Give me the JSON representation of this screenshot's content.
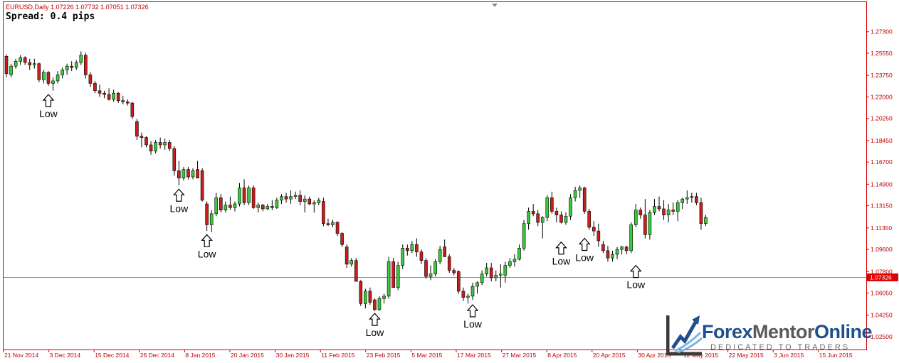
{
  "header": {
    "symbol_line": "EURUSD,Daily  1.07226 1.07732 1.07051 1.07326",
    "spread": "Spread: 0.4 pips"
  },
  "colors": {
    "bull": "#3cc83c",
    "bear": "#c81e1e",
    "frame": "#d00000",
    "price_line": "#8c8c8c",
    "price_tag_bg": "#e00000"
  },
  "logo": {
    "part1": "Forex",
    "part2": "Mentor",
    "part3": "Online",
    "tagline": "DEDICATED TO TRADERS"
  },
  "chart_data": {
    "type": "candlestick",
    "instrument": "EURUSD",
    "timeframe": "Daily",
    "ylim": [
      1.0175,
      1.2838
    ],
    "yticks": [
      "1.27300",
      "1.25550",
      "1.23750",
      "1.22000",
      "1.20250",
      "1.18450",
      "1.16700",
      "1.14900",
      "1.13150",
      "1.11350",
      "1.09600",
      "1.07800",
      "1.06050",
      "1.04250",
      "1.02500"
    ],
    "xticks": [
      "21 Nov 2014",
      "3 Dec 2014",
      "15 Dec 2014",
      "26 Dec 2014",
      "8 Jan 2015",
      "20 Jan 2015",
      "30 Jan 2015",
      "11 Feb 2015",
      "23 Feb 2015",
      "5 Mar 2015",
      "17 Mar 2015",
      "27 Mar 2015",
      "8 Apr 2015",
      "20 Apr 2015",
      "30 Apr 2015",
      "12 May 2015",
      "22 May 2015",
      "3 Jun 2015",
      "15 Jun 2015"
    ],
    "current_price": "1.07326",
    "candles": [
      [
        1.253,
        1.2545,
        1.236,
        1.239
      ],
      [
        1.238,
        1.247,
        1.236,
        1.245
      ],
      [
        1.245,
        1.251,
        1.243,
        1.249
      ],
      [
        1.249,
        1.254,
        1.246,
        1.252
      ],
      [
        1.252,
        1.253,
        1.246,
        1.248
      ],
      [
        1.248,
        1.251,
        1.242,
        1.246
      ],
      [
        1.246,
        1.251,
        1.243,
        1.247
      ],
      [
        1.247,
        1.248,
        1.232,
        1.234
      ],
      [
        1.234,
        1.242,
        1.231,
        1.24
      ],
      [
        1.24,
        1.241,
        1.229,
        1.231
      ],
      [
        1.231,
        1.236,
        1.225,
        1.233
      ],
      [
        1.233,
        1.241,
        1.231,
        1.238
      ],
      [
        1.238,
        1.244,
        1.235,
        1.242
      ],
      [
        1.242,
        1.247,
        1.238,
        1.245
      ],
      [
        1.245,
        1.249,
        1.241,
        1.244
      ],
      [
        1.244,
        1.25,
        1.242,
        1.248
      ],
      [
        1.248,
        1.257,
        1.246,
        1.254
      ],
      [
        1.254,
        1.256,
        1.235,
        1.238
      ],
      [
        1.238,
        1.24,
        1.228,
        1.231
      ],
      [
        1.231,
        1.233,
        1.223,
        1.225
      ],
      [
        1.225,
        1.23,
        1.22,
        1.223
      ],
      [
        1.223,
        1.225,
        1.219,
        1.222
      ],
      [
        1.222,
        1.227,
        1.217,
        1.218
      ],
      [
        1.218,
        1.226,
        1.216,
        1.223
      ],
      [
        1.223,
        1.224,
        1.215,
        1.217
      ],
      [
        1.217,
        1.221,
        1.214,
        1.216
      ],
      [
        1.216,
        1.218,
        1.213,
        1.215
      ],
      [
        1.215,
        1.216,
        1.202,
        1.204
      ],
      [
        1.2,
        1.202,
        1.185,
        1.188
      ],
      [
        1.188,
        1.191,
        1.179,
        1.187
      ],
      [
        1.187,
        1.188,
        1.179,
        1.181
      ],
      [
        1.181,
        1.184,
        1.173,
        1.176
      ],
      [
        1.176,
        1.185,
        1.174,
        1.183
      ],
      [
        1.183,
        1.187,
        1.178,
        1.181
      ],
      [
        1.181,
        1.186,
        1.177,
        1.183
      ],
      [
        1.183,
        1.185,
        1.176,
        1.178
      ],
      [
        1.178,
        1.18,
        1.156,
        1.16
      ],
      [
        1.16,
        1.168,
        1.148,
        1.154
      ],
      [
        1.154,
        1.163,
        1.152,
        1.161
      ],
      [
        1.161,
        1.163,
        1.153,
        1.155
      ],
      [
        1.155,
        1.162,
        1.153,
        1.16
      ],
      [
        1.161,
        1.168,
        1.155,
        1.154
      ],
      [
        1.16,
        1.162,
        1.135,
        1.136
      ],
      [
        1.133,
        1.135,
        1.111,
        1.116
      ],
      [
        1.116,
        1.128,
        1.11,
        1.125
      ],
      [
        1.125,
        1.142,
        1.123,
        1.138
      ],
      [
        1.138,
        1.141,
        1.126,
        1.128
      ],
      [
        1.128,
        1.135,
        1.126,
        1.132
      ],
      [
        1.132,
        1.139,
        1.128,
        1.13
      ],
      [
        1.13,
        1.135,
        1.127,
        1.133
      ],
      [
        1.133,
        1.15,
        1.131,
        1.146
      ],
      [
        1.146,
        1.153,
        1.132,
        1.134
      ],
      [
        1.134,
        1.148,
        1.132,
        1.146
      ],
      [
        1.146,
        1.148,
        1.129,
        1.13
      ],
      [
        1.13,
        1.134,
        1.126,
        1.132
      ],
      [
        1.132,
        1.133,
        1.127,
        1.129
      ],
      [
        1.129,
        1.133,
        1.128,
        1.131
      ],
      [
        1.131,
        1.136,
        1.128,
        1.13
      ],
      [
        1.13,
        1.138,
        1.129,
        1.136
      ],
      [
        1.136,
        1.141,
        1.133,
        1.139
      ],
      [
        1.139,
        1.142,
        1.134,
        1.137
      ],
      [
        1.137,
        1.144,
        1.133,
        1.139
      ],
      [
        1.139,
        1.143,
        1.137,
        1.14
      ],
      [
        1.14,
        1.144,
        1.132,
        1.135
      ],
      [
        1.135,
        1.14,
        1.126,
        1.137
      ],
      [
        1.137,
        1.139,
        1.132,
        1.133
      ],
      [
        1.133,
        1.136,
        1.126,
        1.134
      ],
      [
        1.134,
        1.138,
        1.132,
        1.136
      ],
      [
        1.135,
        1.138,
        1.115,
        1.117
      ],
      [
        1.117,
        1.121,
        1.115,
        1.116
      ],
      [
        1.116,
        1.12,
        1.114,
        1.118
      ],
      [
        1.118,
        1.119,
        1.107,
        1.109
      ],
      [
        1.109,
        1.11,
        1.098,
        1.1
      ],
      [
        1.098,
        1.1,
        1.081,
        1.084
      ],
      [
        1.084,
        1.089,
        1.082,
        1.087
      ],
      [
        1.087,
        1.089,
        1.07,
        1.07
      ],
      [
        1.07,
        1.071,
        1.05,
        1.052
      ],
      [
        1.052,
        1.064,
        1.048,
        1.062
      ],
      [
        1.062,
        1.065,
        1.051,
        1.053
      ],
      [
        1.055,
        1.056,
        1.046,
        1.047
      ],
      [
        1.047,
        1.058,
        1.046,
        1.056
      ],
      [
        1.056,
        1.06,
        1.052,
        1.058
      ],
      [
        1.058,
        1.09,
        1.056,
        1.086
      ],
      [
        1.086,
        1.089,
        1.065,
        1.065
      ],
      [
        1.065,
        1.086,
        1.063,
        1.083
      ],
      [
        1.083,
        1.1,
        1.08,
        1.097
      ],
      [
        1.097,
        1.1,
        1.091,
        1.095
      ],
      [
        1.095,
        1.103,
        1.093,
        1.1
      ],
      [
        1.1,
        1.105,
        1.09,
        1.094
      ],
      [
        1.094,
        1.096,
        1.084,
        1.087
      ],
      [
        1.087,
        1.089,
        1.072,
        1.074
      ],
      [
        1.074,
        1.083,
        1.071,
        1.076
      ],
      [
        1.076,
        1.088,
        1.074,
        1.086
      ],
      [
        1.086,
        1.099,
        1.084,
        1.096
      ],
      [
        1.098,
        1.104,
        1.09,
        1.09
      ],
      [
        1.09,
        1.092,
        1.077,
        1.079
      ],
      [
        1.079,
        1.081,
        1.075,
        1.077
      ],
      [
        1.078,
        1.079,
        1.06,
        1.062
      ],
      [
        1.062,
        1.065,
        1.054,
        1.057
      ],
      [
        1.057,
        1.06,
        1.052,
        1.058
      ],
      [
        1.058,
        1.069,
        1.055,
        1.066
      ],
      [
        1.066,
        1.07,
        1.06,
        1.069
      ],
      [
        1.069,
        1.079,
        1.067,
        1.076
      ],
      [
        1.076,
        1.085,
        1.074,
        1.081
      ],
      [
        1.081,
        1.085,
        1.07,
        1.073
      ],
      [
        1.073,
        1.079,
        1.07,
        1.075
      ],
      [
        1.075,
        1.084,
        1.065,
        1.076
      ],
      [
        1.075,
        1.086,
        1.069,
        1.083
      ],
      [
        1.083,
        1.089,
        1.081,
        1.086
      ],
      [
        1.086,
        1.092,
        1.082,
        1.088
      ],
      [
        1.088,
        1.1,
        1.087,
        1.097
      ],
      [
        1.097,
        1.12,
        1.095,
        1.117
      ],
      [
        1.117,
        1.13,
        1.112,
        1.127
      ],
      [
        1.127,
        1.133,
        1.123,
        1.125
      ],
      [
        1.125,
        1.128,
        1.115,
        1.118
      ],
      [
        1.118,
        1.123,
        1.105,
        1.122
      ],
      [
        1.122,
        1.14,
        1.119,
        1.138
      ],
      [
        1.138,
        1.143,
        1.125,
        1.127
      ],
      [
        1.127,
        1.13,
        1.118,
        1.124
      ],
      [
        1.124,
        1.127,
        1.117,
        1.118
      ],
      [
        1.118,
        1.126,
        1.116,
        1.123
      ],
      [
        1.123,
        1.141,
        1.12,
        1.138
      ],
      [
        1.138,
        1.147,
        1.135,
        1.144
      ],
      [
        1.144,
        1.148,
        1.138,
        1.146
      ],
      [
        1.146,
        1.147,
        1.125,
        1.127
      ],
      [
        1.127,
        1.129,
        1.112,
        1.114
      ],
      [
        1.114,
        1.119,
        1.107,
        1.111
      ],
      [
        1.111,
        1.117,
        1.098,
        1.103
      ],
      [
        1.1,
        1.103,
        1.093,
        1.095
      ],
      [
        1.095,
        1.099,
        1.086,
        1.089
      ],
      [
        1.089,
        1.095,
        1.086,
        1.092
      ],
      [
        1.092,
        1.098,
        1.088,
        1.096
      ],
      [
        1.096,
        1.099,
        1.092,
        1.098
      ],
      [
        1.098,
        1.099,
        1.092,
        1.095
      ],
      [
        1.095,
        1.118,
        1.093,
        1.116
      ],
      [
        1.116,
        1.133,
        1.114,
        1.128
      ],
      [
        1.128,
        1.13,
        1.121,
        1.124
      ],
      [
        1.124,
        1.137,
        1.105,
        1.108
      ],
      [
        1.108,
        1.128,
        1.104,
        1.126
      ],
      [
        1.126,
        1.137,
        1.124,
        1.131
      ],
      [
        1.131,
        1.139,
        1.127,
        1.129
      ],
      [
        1.129,
        1.136,
        1.12,
        1.124
      ],
      [
        1.124,
        1.133,
        1.118,
        1.128
      ],
      [
        1.128,
        1.134,
        1.124,
        1.127
      ],
      [
        1.127,
        1.136,
        1.119,
        1.134
      ],
      [
        1.134,
        1.138,
        1.129,
        1.137
      ],
      [
        1.137,
        1.144,
        1.133,
        1.138
      ],
      [
        1.138,
        1.142,
        1.134,
        1.139
      ],
      [
        1.139,
        1.142,
        1.132,
        1.134
      ],
      [
        1.134,
        1.138,
        1.112,
        1.117
      ],
      [
        1.117,
        1.124,
        1.115,
        1.122
      ]
    ],
    "annotations": [
      {
        "candle": 9,
        "y": 1.222,
        "text": "Low"
      },
      {
        "candle": 37,
        "y": 1.145,
        "text": "Low"
      },
      {
        "candle": 43,
        "y": 1.108,
        "text": "Low"
      },
      {
        "candle": 79,
        "y": 1.044,
        "text": "Low"
      },
      {
        "candle": 100,
        "y": 1.051,
        "text": "Low"
      },
      {
        "candle": 119,
        "y": 1.102,
        "text": "Low"
      },
      {
        "candle": 124,
        "y": 1.105,
        "text": "Low"
      },
      {
        "candle": 135,
        "y": 1.083,
        "text": "Low"
      }
    ]
  }
}
